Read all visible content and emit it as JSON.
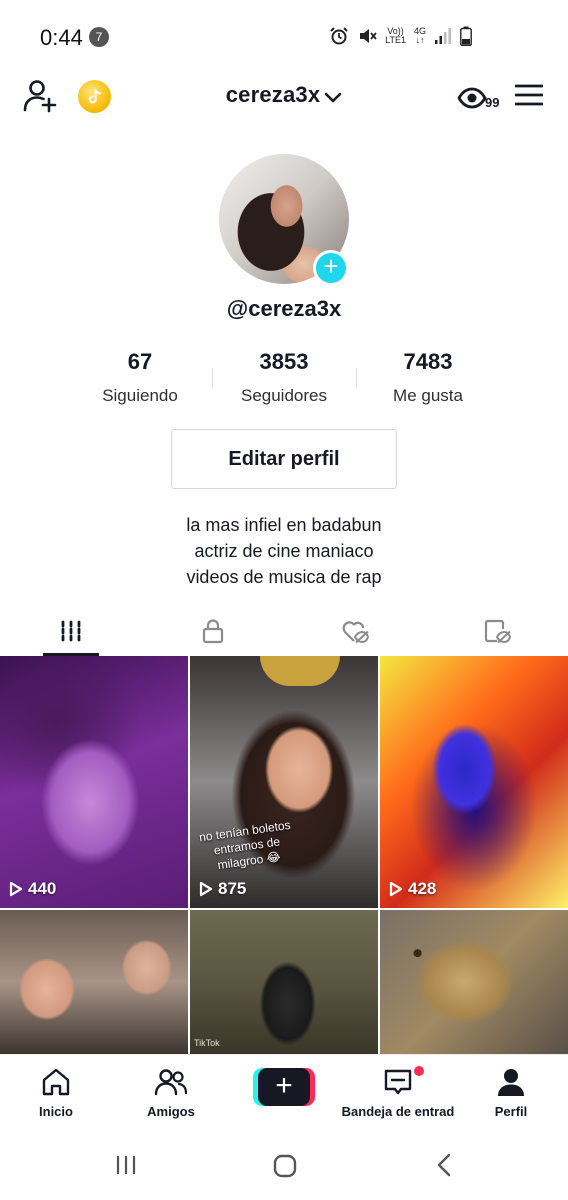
{
  "status_bar": {
    "time": "0:44",
    "notification_count": "7",
    "network_top": "Vo))",
    "network_bottom": "LTE1",
    "network_type": "4G"
  },
  "header": {
    "username": "cereza3x",
    "profile_views_count": "99"
  },
  "profile": {
    "handle": "@cereza3x",
    "stats": [
      {
        "value": "67",
        "label": "Siguiendo"
      },
      {
        "value": "3853",
        "label": "Seguidores"
      },
      {
        "value": "7483",
        "label": "Me gusta"
      }
    ],
    "edit_button_label": "Editar perfil",
    "bio_lines": [
      "la mas infiel en badabun",
      "actriz de cine maniaco",
      "videos de musica de rap"
    ]
  },
  "tabs": [
    {
      "name": "videos",
      "icon": "grid-icon",
      "active": true
    },
    {
      "name": "private",
      "icon": "lock-icon",
      "active": false
    },
    {
      "name": "liked",
      "icon": "heart-hidden-icon",
      "active": false
    },
    {
      "name": "favorites",
      "icon": "bookmark-hidden-icon",
      "active": false
    }
  ],
  "videos": [
    {
      "views": "440"
    },
    {
      "views": "875",
      "caption": "no tenían boletos entramos de milagroo 😂"
    },
    {
      "views": "428"
    },
    {
      "views": ""
    },
    {
      "views": "",
      "watermark": "TikTok"
    },
    {
      "views": ""
    }
  ],
  "bottom_nav": [
    {
      "label": "Inicio",
      "icon": "home-icon"
    },
    {
      "label": "Amigos",
      "icon": "friends-icon"
    },
    {
      "label": "",
      "icon": "create-plus-icon"
    },
    {
      "label": "Bandeja de entrad",
      "icon": "inbox-icon",
      "has_badge": true
    },
    {
      "label": "Perfil",
      "icon": "profile-icon",
      "active": true
    }
  ],
  "colors": {
    "accent_cyan": "#20d5ec",
    "accent_red": "#fe2c55",
    "text_primary": "#161823",
    "coin_gold": "#f5b800"
  }
}
